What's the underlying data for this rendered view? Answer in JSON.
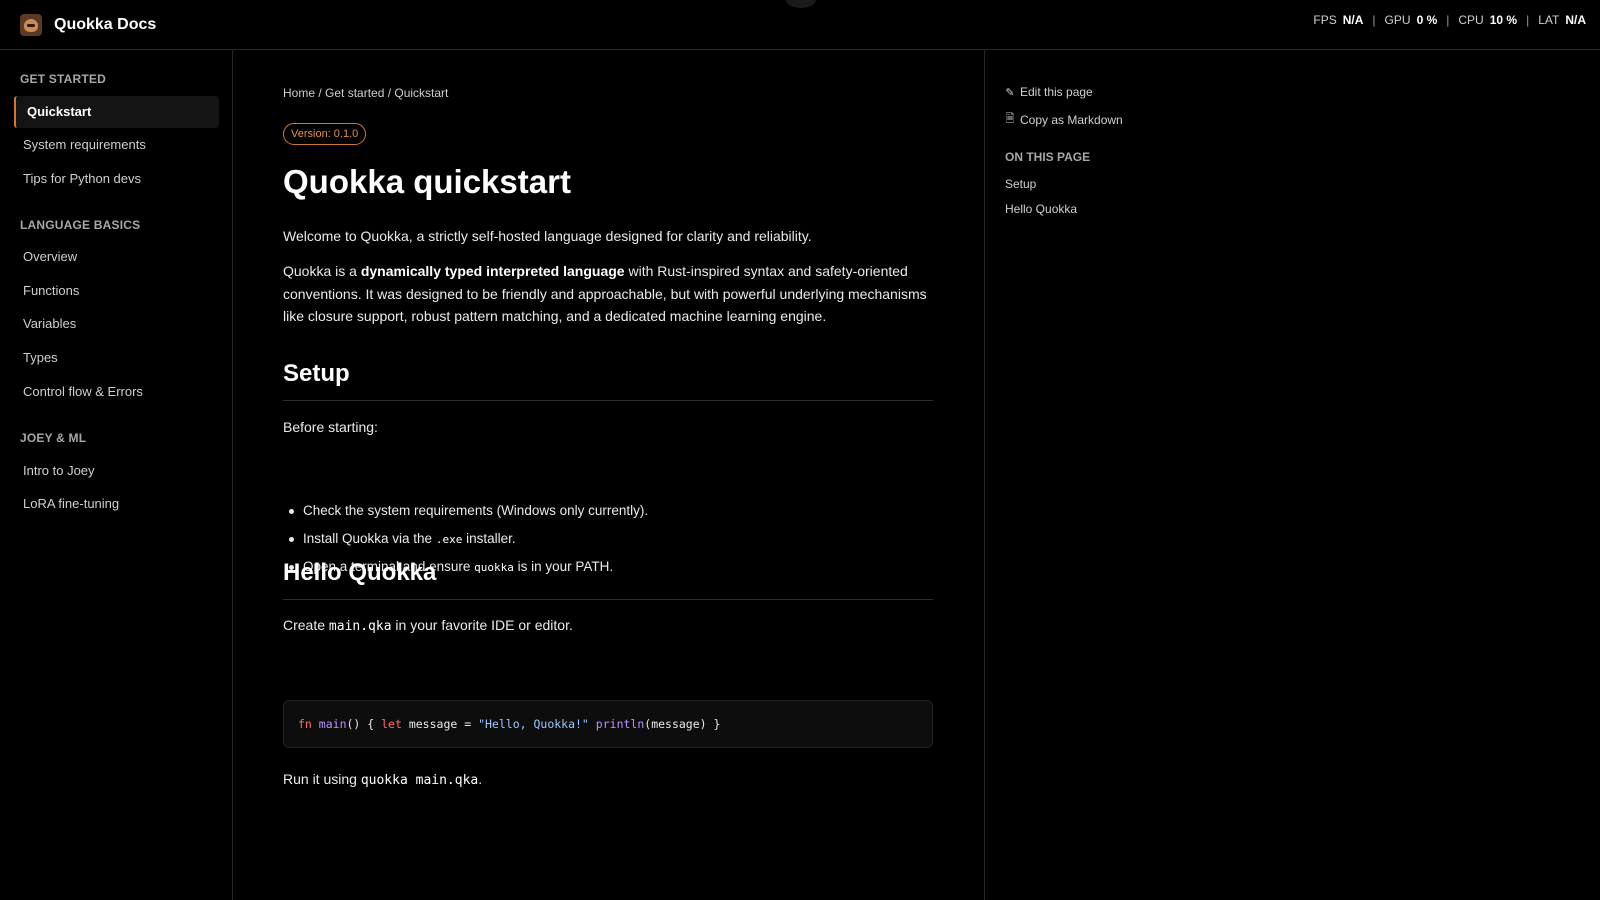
{
  "header": {
    "title": "Quokka Docs",
    "logo_icon": "quokka-logo-icon",
    "stats": {
      "fps_label": "FPS",
      "fps_value": "N/A",
      "gpu_label": "GPU",
      "gpu_value": "0 %",
      "cpu_label": "CPU",
      "cpu_value": "10 %",
      "lat_label": "LAT",
      "lat_value": "N/A",
      "separator": "|"
    }
  },
  "sidebar": {
    "sections": [
      {
        "title": "GET STARTED",
        "items": [
          "Quickstart",
          "System requirements",
          "Tips for Python devs"
        ]
      },
      {
        "title": "LANGUAGE BASICS",
        "items": [
          "Overview",
          "Functions",
          "Variables",
          "Types",
          "Control flow & Errors"
        ]
      },
      {
        "title": "JOEY & ML",
        "items": [
          "Intro to Joey",
          "LoRA fine-tuning"
        ]
      }
    ],
    "active_item": "Quickstart",
    "accent_color": "#c97a3a"
  },
  "main": {
    "breadcrumb": "Home / Get started / Quickstart",
    "version": "Version: 0.1.0",
    "title": "Quokka quickstart",
    "intro": "Welcome to Quokka, a strictly self-hosted language designed for clarity and reliability.",
    "desc_pre": "Quokka is a ",
    "desc_bold": "dynamically typed interpreted language",
    "desc_post": " with Rust-inspired syntax and safety-oriented conventions. It was designed to be friendly and approachable, but with powerful underlying mechanisms like closure support, robust pattern matching, and a dedicated machine learning engine.",
    "setup": {
      "heading": "Setup",
      "before": "Before starting:",
      "bullet1": "Check the system requirements (Windows only currently).",
      "bullet2_pre": "Install Quokka via the ",
      "bullet2_code": ".exe",
      "bullet2_post": " installer.",
      "bullet3_pre": "Open a terminal and ensure ",
      "bullet3_code": "quokka",
      "bullet3_post": " is in your PATH."
    },
    "hello": {
      "heading": "Hello Quokka",
      "create_pre": "Create ",
      "create_code": "main.qka",
      "create_post": " in your favorite IDE or editor.",
      "code": {
        "kw_fn": "fn",
        "fn_main": "main",
        "t1": "() { ",
        "kw_let": "let",
        "t2": " message = ",
        "str": "\"Hello, Quokka!\"",
        "t3": " ",
        "fn_println": "println",
        "t4": "(message) }"
      },
      "run_pre": "Run it using ",
      "run_code": "quokka main.qka",
      "run_post": "."
    }
  },
  "right": {
    "edit_label": "Edit this page",
    "edit_icon": "pencil-icon",
    "copy_label": "Copy as Markdown",
    "copy_icon": "document-icon",
    "on_this_page": "ON THIS PAGE",
    "toc": [
      "Setup",
      "Hello Quokka"
    ]
  }
}
